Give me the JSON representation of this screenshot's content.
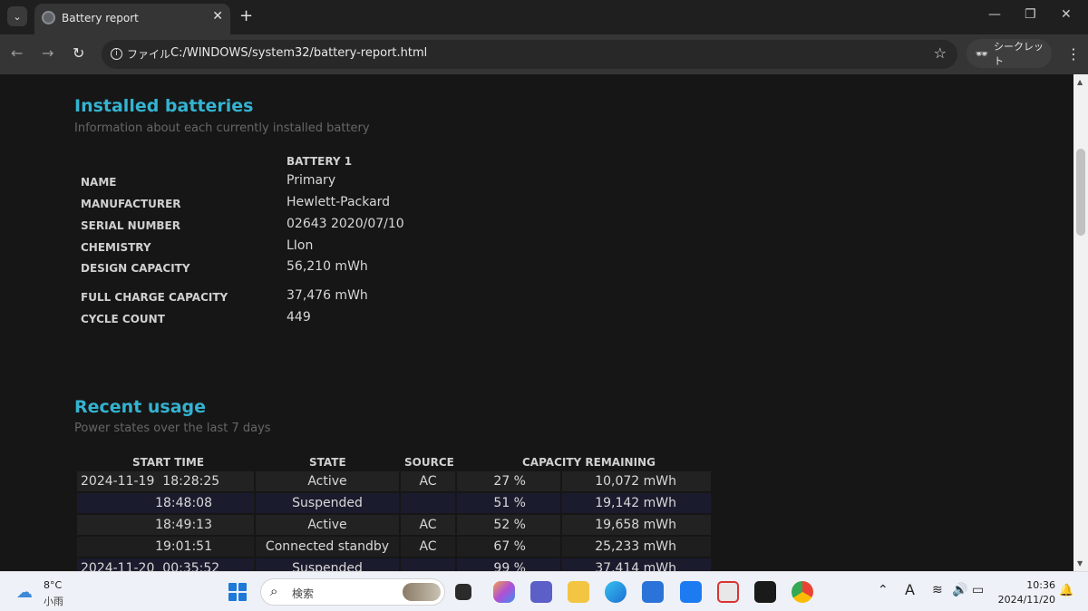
{
  "browser": {
    "tab_title": "Battery report",
    "address_label": "ファイル",
    "url": "C:/WINDOWS/system32/battery-report.html",
    "incognito_label": "シークレット"
  },
  "installed": {
    "title": "Installed batteries",
    "subtitle": "Information about each currently installed battery",
    "column_header": "BATTERY 1",
    "rows": [
      {
        "label": "NAME",
        "value": "Primary"
      },
      {
        "label": "MANUFACTURER",
        "value": "Hewlett-Packard"
      },
      {
        "label": "SERIAL NUMBER",
        "value": "02643 2020/07/10"
      },
      {
        "label": "CHEMISTRY",
        "value": "LIon"
      },
      {
        "label": "DESIGN CAPACITY",
        "value": "56,210 mWh"
      },
      {
        "label": "FULL CHARGE CAPACITY",
        "value": "37,476 mWh"
      },
      {
        "label": "CYCLE COUNT",
        "value": "449"
      }
    ]
  },
  "recent": {
    "title": "Recent usage",
    "subtitle": "Power states over the last 7 days",
    "headers": {
      "start": "START TIME",
      "state": "STATE",
      "source": "SOURCE",
      "capacity": "CAPACITY REMAINING"
    },
    "rows": [
      {
        "date": "2024-11-19",
        "time": "18:28:25",
        "state": "Active",
        "source": "AC",
        "percent": "27 %",
        "mwh": "10,072 mWh"
      },
      {
        "date": "",
        "time": "18:48:08",
        "state": "Suspended",
        "source": "",
        "percent": "51 %",
        "mwh": "19,142 mWh"
      },
      {
        "date": "",
        "time": "18:49:13",
        "state": "Active",
        "source": "AC",
        "percent": "52 %",
        "mwh": "19,658 mWh"
      },
      {
        "date": "",
        "time": "19:01:51",
        "state": "Connected standby",
        "source": "AC",
        "percent": "67 %",
        "mwh": "25,233 mWh"
      },
      {
        "date": "2024-11-20",
        "time": "00:35:52",
        "state": "Suspended",
        "source": "",
        "percent": "99 %",
        "mwh": "37,414 mWh"
      }
    ]
  },
  "taskbar": {
    "temperature": "8°C",
    "weather": "小雨",
    "search_placeholder": "検索",
    "time": "10:36",
    "date": "2024/11/20"
  },
  "colors": {
    "accent": "#34b3d1",
    "row_active": "#222222",
    "row_suspended": "#1b1b2e",
    "chrome_dark": "#1f1f1f"
  }
}
